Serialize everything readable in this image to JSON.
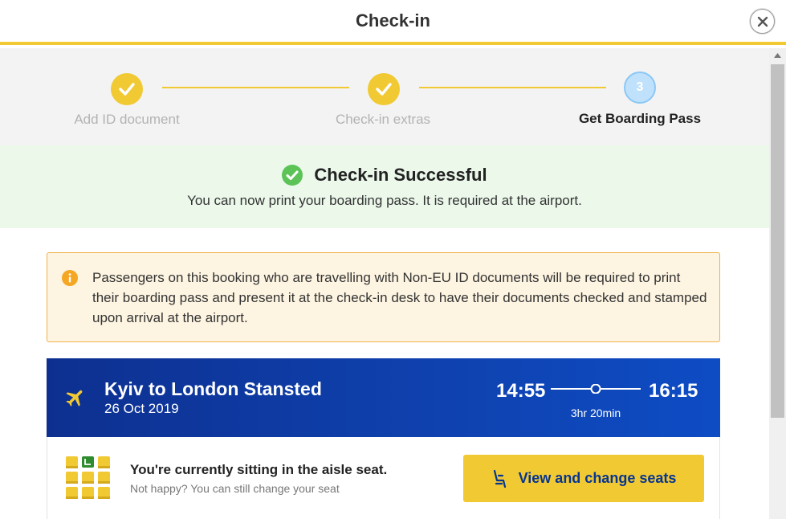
{
  "header": {
    "title": "Check-in"
  },
  "stepper": {
    "steps": [
      {
        "label": "Add ID document",
        "state": "done"
      },
      {
        "label": "Check-in extras",
        "state": "done"
      },
      {
        "label": "Get Boarding Pass",
        "state": "current",
        "number": "3"
      }
    ]
  },
  "success": {
    "title": "Check-in Successful",
    "subtitle": "You can now print your boarding pass. It is required at the airport."
  },
  "notice": {
    "text": "Passengers on this booking who are travelling with Non-EU ID documents will be required to print their boarding pass and present it at the check-in desk to have their documents checked and stamped upon arrival at the airport."
  },
  "flight": {
    "route": "Kyiv to London Stansted",
    "date": "26 Oct 2019",
    "departure": "14:55",
    "arrival": "16:15",
    "duration": "3hr 20min"
  },
  "seat": {
    "title": "You're currently sitting in the aisle seat.",
    "subtitle": "Not happy? You can still change your seat",
    "button_label": "View and change seats"
  },
  "colors": {
    "accent_yellow": "#f1c933",
    "brand_blue": "#073590",
    "success_green": "#5cc357",
    "warning_orange": "#f5a623"
  },
  "icons": {
    "close": "close-icon",
    "check": "check-icon",
    "info": "info-icon",
    "plane": "plane-icon",
    "seat": "seat-icon"
  }
}
